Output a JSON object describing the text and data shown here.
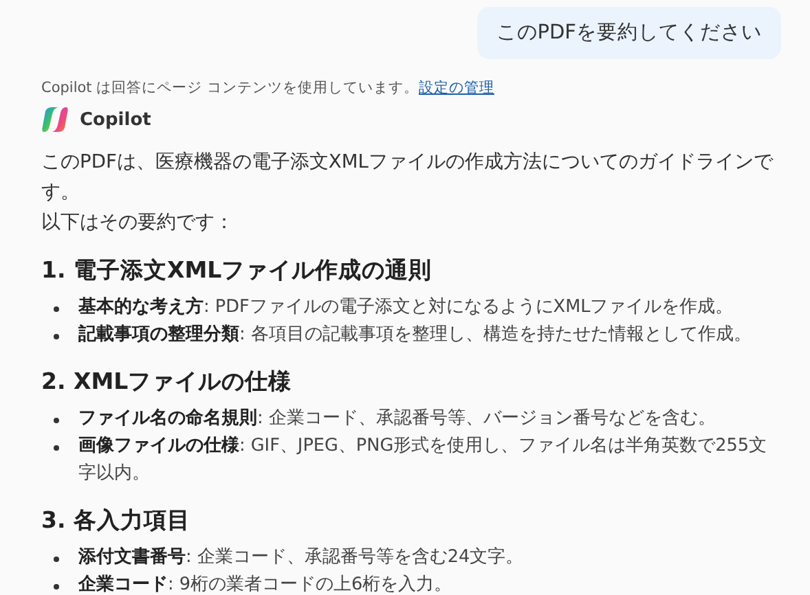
{
  "user_message": "このPDFを要約してください",
  "notice": {
    "text": "Copilot は回答にページ コンテンツを使用しています。",
    "link": "設定の管理"
  },
  "assistant": {
    "name": "Copilot"
  },
  "intro": [
    "このPDFは、医療機器の電子添文XMLファイルの作成方法についてのガイドラインです。",
    "以下はその要約です："
  ],
  "sections": [
    {
      "heading": "1. 電子添文XMLファイル作成の通則",
      "items": [
        "**基本的な考え方**: PDFファイルの電子添文と対になるようにXMLファイルを作成。",
        "**記載事項の整理分類**: 各項目の記載事項を整理し、構造を持たせた情報として作成。"
      ]
    },
    {
      "heading": "2. XMLファイルの仕様",
      "items": [
        "**ファイル名の命名規則**: 企業コード、承認番号等、バージョン番号などを含む。",
        "**画像ファイルの仕様**: GIF、JPEG、PNG形式を使用し、ファイル名は半角英数で255文字以内。"
      ]
    },
    {
      "heading": "3. 各入力項目",
      "items": [
        "**添付文書番号**: 企業コード、承認番号等を含む24文字。",
        "**企業コード**: 9桁の業者コードの上6桁を入力。"
      ]
    }
  ]
}
